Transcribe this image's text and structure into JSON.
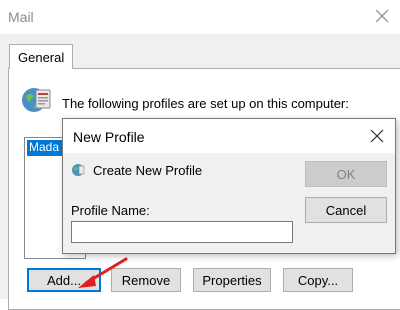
{
  "window": {
    "title": "Mail"
  },
  "tabs": [
    {
      "label": "General"
    }
  ],
  "main": {
    "profiles_text": "The following profiles are set up on this computer:",
    "profiles": [
      "Mada"
    ]
  },
  "buttons": {
    "add": "Add...",
    "remove": "Remove",
    "properties": "Properties",
    "copy": "Copy..."
  },
  "dialog": {
    "title": "New Profile",
    "subtitle": "Create New Profile",
    "ok": "OK",
    "cancel": "Cancel",
    "name_label": "Profile Name:",
    "name_value": ""
  },
  "colors": {
    "selection": "#0078d7",
    "arrow": "#e02020",
    "accent": "#0078d7"
  },
  "icons": {
    "mail_globe": "mail-globe-icon",
    "close": "close-icon",
    "arrow": "arrow-icon"
  }
}
